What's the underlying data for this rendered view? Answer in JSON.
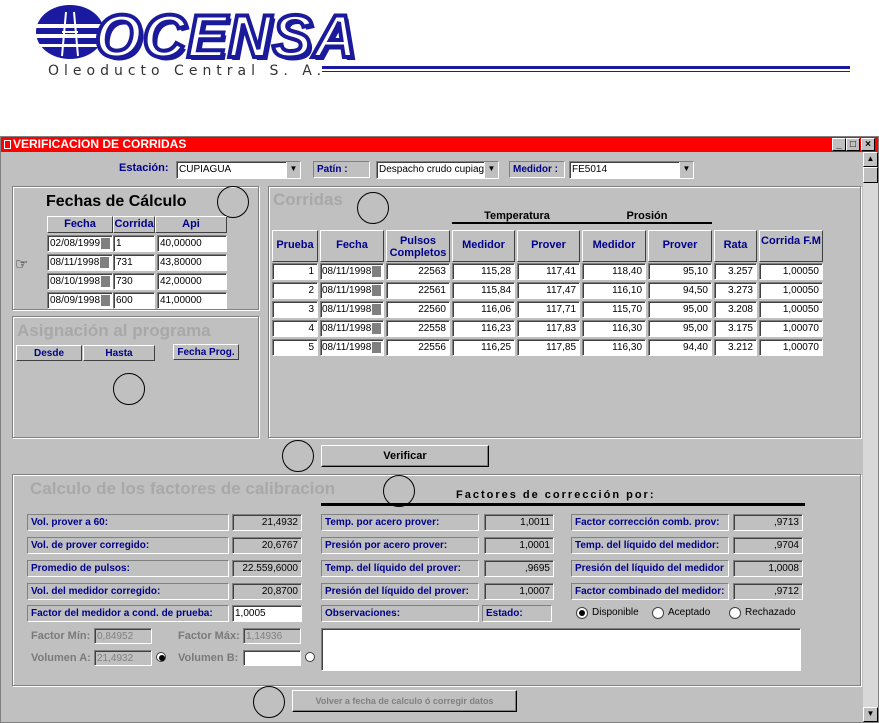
{
  "logo": {
    "brand": "OCENSA",
    "subtitle": "Oleoducto  Central  S.  A."
  },
  "window": {
    "title": "VERIFICACION DE CORRIDAS",
    "min": "_",
    "max": "□",
    "close": "×"
  },
  "toolbar": {
    "estacion_label": "Estación:",
    "estacion_value": "CUPIAGUA",
    "patin_label": "Patín :",
    "patin_value": "Despacho crudo cupiagr",
    "medidor_label": "Medidor :",
    "medidor_value": "FE5014"
  },
  "fechas": {
    "title": "Fechas de Cálculo",
    "headers": [
      "Fecha",
      "Corrida",
      "Api"
    ],
    "rows": [
      {
        "fecha": "02/08/1999",
        "corrida": "1",
        "api": "40,00000"
      },
      {
        "fecha": "08/11/1998",
        "corrida": "731",
        "api": "43,80000"
      },
      {
        "fecha": "08/10/1998",
        "corrida": "730",
        "api": "42,00000"
      },
      {
        "fecha": "08/09/1998",
        "corrida": "600",
        "api": "41,00000"
      }
    ]
  },
  "asignacion": {
    "title": "Asignación al programa",
    "desde": "Desde",
    "hasta": "Hasta",
    "fecha_prog": "Fecha Prog."
  },
  "corridas": {
    "title": "Corridas",
    "group_temp": "Temperatura",
    "group_pres": "Prosión",
    "headers": [
      "Prueba",
      "Fecha",
      "Pulsos Completos",
      "Medidor",
      "Prover",
      "Medidor",
      "Prover",
      "Rata",
      "Corrida F.M"
    ],
    "rows": [
      [
        "1",
        "08/11/1998",
        "22563",
        "115,28",
        "117,41",
        "118,40",
        "95,10",
        "3.257",
        "1,00050"
      ],
      [
        "2",
        "08/11/1998",
        "22561",
        "115,84",
        "117,47",
        "116,10",
        "94,50",
        "3.273",
        "1,00050"
      ],
      [
        "3",
        "08/11/1998",
        "22560",
        "116,06",
        "117,71",
        "115,70",
        "95,00",
        "3.208",
        "1,00050"
      ],
      [
        "4",
        "08/11/1998",
        "22558",
        "116,23",
        "117,83",
        "116,30",
        "95,00",
        "3.175",
        "1,00070"
      ],
      [
        "5",
        "08/11/1998",
        "22556",
        "116,25",
        "117,85",
        "116,30",
        "94,40",
        "3.212",
        "1,00070"
      ]
    ]
  },
  "verificar": "Verificar",
  "calculo": {
    "title": "Calculo de los factores de calibracion",
    "factores_title": "Factores de corrección por:",
    "left": [
      {
        "label": "Vol. prover a 60:",
        "value": "21,4932"
      },
      {
        "label": "Vol. de prover corregido:",
        "value": "20,6767"
      },
      {
        "label": "Promedio de pulsos:",
        "value": "22.559,6000"
      },
      {
        "label": "Vol. del  medidor corregido:",
        "value": "20,8700"
      }
    ],
    "middle": [
      {
        "label": "Temp. por acero prover:",
        "value": "1,0011"
      },
      {
        "label": "Presión por acero prover:",
        "value": "1,0001"
      },
      {
        "label": "Temp. del líquido del prover:",
        "value": ",9695"
      },
      {
        "label": "Presión del líquido del prover:",
        "value": "1,0007"
      }
    ],
    "right": [
      {
        "label": "Factor corrección comb. prov:",
        "value": ",9713"
      },
      {
        "label": "Temp. del líquido del medidor:",
        "value": ",9704"
      },
      {
        "label": "Presión del líquido del medidor",
        "value": "1,0008"
      },
      {
        "label": "Factor combinado del medidor:",
        "value": ",9712"
      }
    ],
    "factor_medidor_label": "Factor del medidor a cond. de prueba:",
    "factor_medidor_value": "1,0005",
    "observaciones": "Observaciones:",
    "estado": "Estado:",
    "radios": [
      "Disponible",
      "Aceptado",
      "Rechazado"
    ],
    "factor_min_label": "Factor Mín:",
    "factor_min_value": "0,84952",
    "factor_max_label": "Factor Máx:",
    "factor_max_value": "1,14936",
    "volumen_a_label": "Volumen A:",
    "volumen_a_value": "21,4932",
    "volumen_b_label": "Volumen B:",
    "volumen_b_value": ""
  },
  "volver": "Volver a fecha de calculo ó corregir datos"
}
